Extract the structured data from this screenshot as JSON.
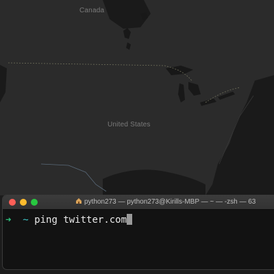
{
  "map": {
    "labels": {
      "canada": "Canada",
      "united_states": "United States"
    }
  },
  "terminal": {
    "title": "python273 — python273@Kirills-MBP — ~ — -zsh — 63",
    "prompt_symbol": "➜",
    "cwd": "~",
    "command": "ping twitter.com"
  }
}
